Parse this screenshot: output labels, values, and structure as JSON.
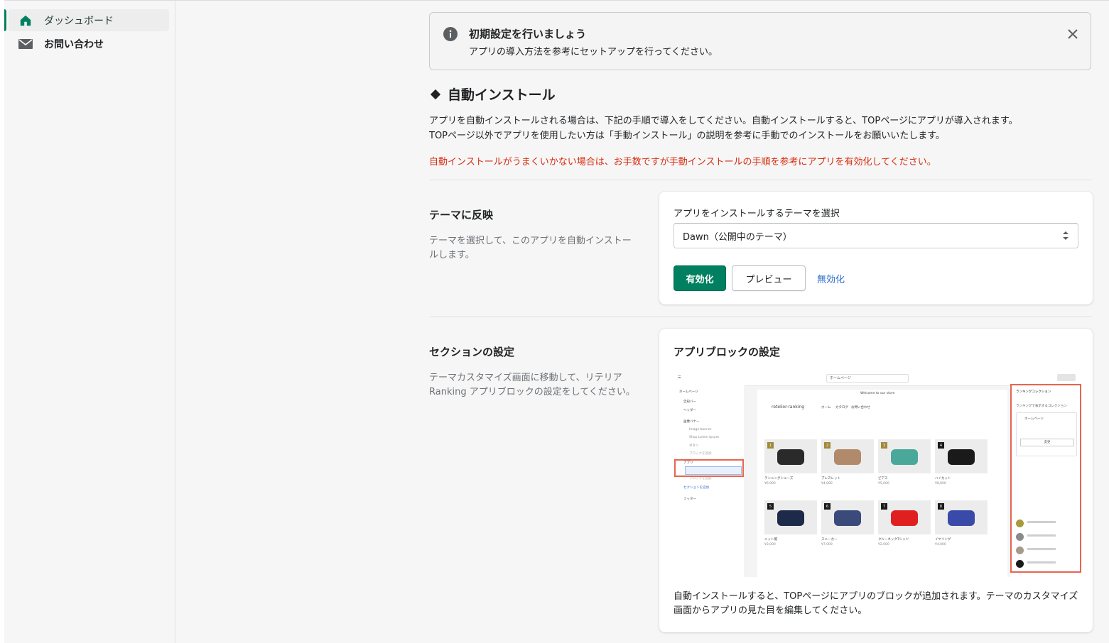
{
  "sidebar": {
    "items": [
      {
        "label": "ダッシュボード",
        "icon": "home-icon",
        "active": true
      },
      {
        "label": "お問い合わせ",
        "icon": "mail-icon",
        "active": false
      }
    ]
  },
  "banner": {
    "title": "初期設定を行いましょう",
    "body": "アプリの導入方法を参考にセットアップを行ってください。",
    "icon": "info-icon"
  },
  "auto_install": {
    "heading": "自動インストール",
    "desc_line1": "アプリを自動インストールされる場合は、下記の手順で導入をしてください。自動インストールすると、TOPページにアプリが導入されます。",
    "desc_line2": "TOPページ以外でアプリを使用したい方は「手動インストール」の説明を参考に手動でのインストールをお願いいたします。",
    "warning": "自動インストールがうまくいかない場合は、お手数ですが手動インストールの手順を参考にアプリを有効化してください。"
  },
  "theme_section": {
    "title": "テーマに反映",
    "desc": "テーマを選択して、このアプリを自動インストールします。",
    "select_label": "アプリをインストールするテーマを選択",
    "selected_theme": "Dawn（公開中のテーマ）",
    "enable_label": "有効化",
    "preview_label": "プレビュー",
    "disable_label": "無効化"
  },
  "section_settings": {
    "title": "セクションの設定",
    "desc": "テーマカスタマイズ画面に移動して、リテリア Ranking アプリブロックの設定をしてください。",
    "card_title": "アプリブロックの設定",
    "card_foot": "自動インストールすると、TOPページにアプリのブロックが追加されます。テーマのカスタマイズ画面からアプリの見た目を編集してください。"
  },
  "mock": {
    "store_name": "retelior-ranking",
    "nav": [
      "ホーム",
      "カタログ",
      "お問い合わせ"
    ],
    "welcome": "Welcome to our store",
    "page_select": "ホームページ",
    "left_items": [
      "ホームページ",
      "告知バー",
      "ヘッダー",
      "画像バナー",
      "Image banner",
      "Shop Lorem Ipsum",
      "ボタン",
      "ブロックを追加",
      "アプリ",
      "ブロックを追加",
      "セクションを追加",
      "フッター"
    ],
    "products": [
      {
        "num": "1",
        "name": "ランニングシューズ",
        "price": "¥6,000",
        "color": "#2a2a2a"
      },
      {
        "num": "2",
        "name": "ブレスレット",
        "price": "¥4,000",
        "color": "#b08a6a"
      },
      {
        "num": "3",
        "name": "ピアス",
        "price": "¥5,000",
        "color": "#4aa89a"
      },
      {
        "num": "4",
        "name": "ハイカット",
        "price": "¥8,000",
        "color": "#1a1a1a"
      },
      {
        "num": "5",
        "name": "ニット帽",
        "price": "¥3,000",
        "color": "#1d2a4a"
      },
      {
        "num": "6",
        "name": "スニーカー",
        "price": "¥7,000",
        "color": "#3a4a7a"
      },
      {
        "num": "7",
        "name": "クルーネックTシャツ",
        "price": "¥2,000",
        "color": "#e02020"
      },
      {
        "num": "8",
        "name": "イヤリング",
        "price": "¥4,000",
        "color": "#3a4aa8"
      }
    ],
    "right_panel": {
      "title": "ランキングコレクション",
      "sub": "ランキングで表示するコレクション",
      "collection": "ホームページ",
      "change": "変更",
      "colors": [
        "#a89a3a",
        "#8a8a8a",
        "#a89a8a",
        "#1a1a1a"
      ]
    }
  },
  "colors": {
    "primary": "#008060",
    "warning": "#d82c0d",
    "link": "#2c6ecb"
  }
}
